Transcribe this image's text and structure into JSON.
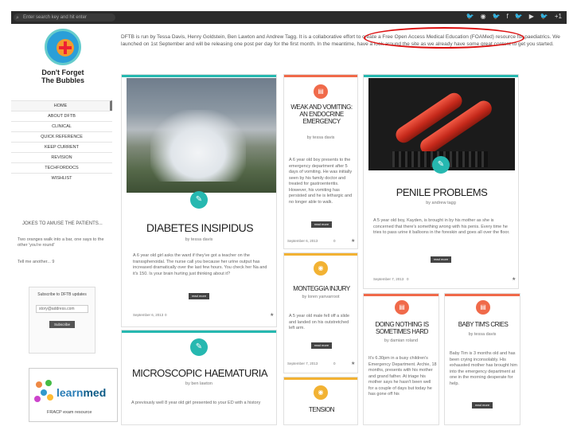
{
  "topbar": {
    "search_placeholder": "Enter search key and hit enter",
    "social_icons": [
      "twitter-icon",
      "rss-icon",
      "twitter-icon",
      "facebook-icon",
      "twitter-icon",
      "youtube-icon",
      "twitter-icon",
      "google-plus-icon"
    ],
    "plus_label": "+1"
  },
  "logo": {
    "line1": "Don't Forget",
    "line2": "The Bubbles"
  },
  "nav": {
    "items": [
      "HOME",
      "ABOUT DFTB",
      "CLINICAL",
      "QUICK REFERENCE",
      "KEEP CURRENT",
      "REVISION",
      "TECHFORDOCS",
      "WISHLIST"
    ]
  },
  "jokes": {
    "heading": "JOKES TO AMUSE THE PATIENTS...",
    "text": "Two oranges walk into a bar, one says to the other 'you're round'",
    "more": "Tell me another... 9"
  },
  "subscribe": {
    "heading": "Subscribe to DFTB updates",
    "email_value": "story@address.com",
    "button": "Subscribe"
  },
  "learnmed": {
    "logo_text_a": "learn",
    "logo_text_b": "med",
    "subtitle": "FRACP exam resource"
  },
  "intro": "DFTB is run by Tessa Davis, Henry Goldstein, Ben Lawton and Andrew Tagg. It is a collaborative effort to create a Free Open Access Medical Education (FOAMed) resource for paediatrics. We launched on 1st September and will be releasing one post per day for the first month. In the meantime, have a look around the site as we already have some great content to get you started.",
  "posts": [
    {
      "title": "DIABETES INSIPIDUS",
      "by": "by tessa davis",
      "excerpt": "A 6 year old girl asks the ward if they've got a teacher on the transsphenoidal. The nurse call you because her urine output has increased dramatically over the last few hours. You check her Na and it's 150. Is your brain hurting just thinking about it?",
      "read": "read more",
      "date": "September 6, 2013",
      "comments": "0"
    },
    {
      "title": "WEAK AND VOMITING: AN ENDOCRINE EMERGENCY",
      "by": "by tessa davis",
      "excerpt": "A 6 year old boy presents to the emergency department after 5 days of vomiting. He was initially seen by his family doctor and treated for gastroenteritis. However, his vomiting has persisted and he is lethargic and no longer able to walk.",
      "read": "read more",
      "date": "September 6, 2013",
      "comments": "0"
    },
    {
      "title": "PENILE PROBLEMS",
      "by": "by andrew tagg",
      "excerpt": "A 5 year old boy, Kayden, is brought in by his mother as she is concerned that there's something wrong with his penis. Every time he tries to pass urine it balloons in the foreskin and goes all over the floor.",
      "read": "read more",
      "date": "September 7, 2013",
      "comments": "0"
    },
    {
      "title": "MONTEGGIA INJURY",
      "by": "by loren yanvarroot",
      "excerpt": "A 5 year old male fell off a slide and landed on his outstretched left arm.",
      "read": "read more",
      "date": "September 7, 2013",
      "comments": "0"
    },
    {
      "title": "MICROSCOPIC HAEMATURIA",
      "by": "by ben lawton",
      "excerpt": "A previously well 8 year old girl presented to your ED with a history"
    },
    {
      "title": "DOING NOTHING IS SOMETIMES HARD",
      "by": "by damian roland",
      "excerpt": "It's 6.30pm in a busy children's Emergency Department. Archie, 18 months, presents with his mother and grand father. At triage his mother says he hasn't been well for a couple of days but today he has gone off his"
    },
    {
      "title": "BABY TIM'S CRIES",
      "by": "by tessa davis",
      "excerpt": "Baby Tim is 3 months old and has been crying inconsolably. His exhausted mother has brought him into the emergency department at one in the morning desperate for help.",
      "read": "read more"
    },
    {
      "title": "TENSION",
      "by": ""
    }
  ],
  "colors": {
    "teal": "#26b8b0",
    "salmon": "#f06a4a",
    "amber": "#f2b233",
    "oval": "#d11111"
  }
}
